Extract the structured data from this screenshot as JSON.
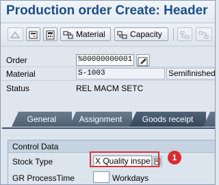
{
  "window": {
    "title": "Production order Create: Header"
  },
  "toolbar": {
    "material_label": "Material",
    "capacity_label": "Capacity"
  },
  "header_fields": {
    "order": {
      "label": "Order",
      "value": "%00000000001"
    },
    "material": {
      "label": "Material",
      "value": "S-1003",
      "description": "Semifinished"
    },
    "status": {
      "label": "Status",
      "value": "REL  MACM SETC"
    }
  },
  "tabs": [
    {
      "label": "General"
    },
    {
      "label": "Assignment"
    },
    {
      "label": "Goods receipt",
      "active": true
    }
  ],
  "control_data": {
    "title": "Control Data",
    "stock_type": {
      "label": "Stock Type",
      "value": "X Quality inspe"
    },
    "gr_processing_time": {
      "label": "GR ProcessTime",
      "value": "",
      "unit": "Workdays"
    }
  },
  "callout": {
    "number": "1",
    "color": "#d92b33"
  },
  "colors": {
    "title": "#1d4f85",
    "tab": "#4e5f72",
    "highlight": "#d9333a"
  }
}
